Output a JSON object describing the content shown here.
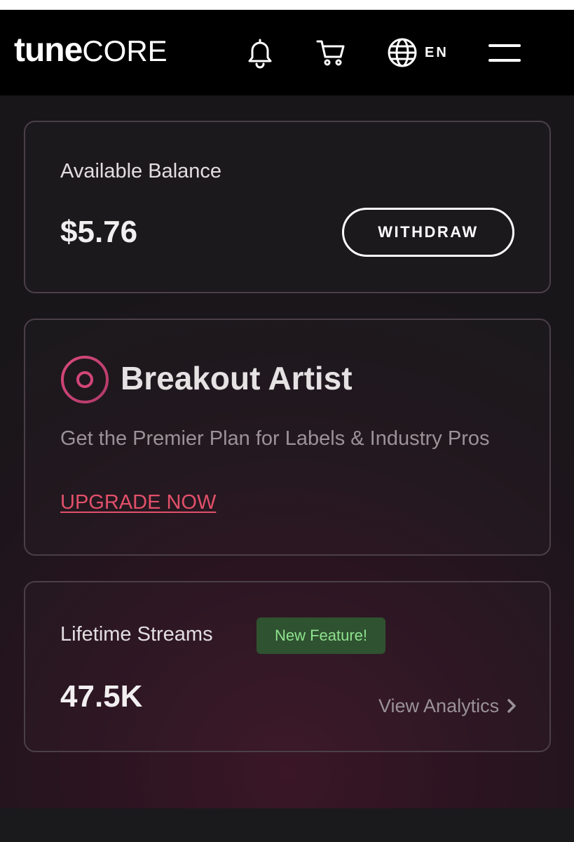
{
  "header": {
    "logo_tune": "tune",
    "logo_core": "CORE",
    "icons": [
      "bell-icon",
      "cart-icon",
      "globe-icon",
      "menu-icon"
    ],
    "language": "EN"
  },
  "balance": {
    "label": "Available Balance",
    "amount": "$5.76",
    "withdraw_label": "WITHDRAW"
  },
  "breakout": {
    "icon": "record-icon",
    "title": "Breakout Artist",
    "description": "Get the Premier Plan for Labels & Industry Pros",
    "upgrade_label": "UPGRADE NOW",
    "accent_color": "#e2506a"
  },
  "streams": {
    "label": "Lifetime Streams",
    "badge": "New Feature!",
    "value": "47.5K",
    "link_label": "View Analytics",
    "link_icon": "chevron-right-icon"
  }
}
